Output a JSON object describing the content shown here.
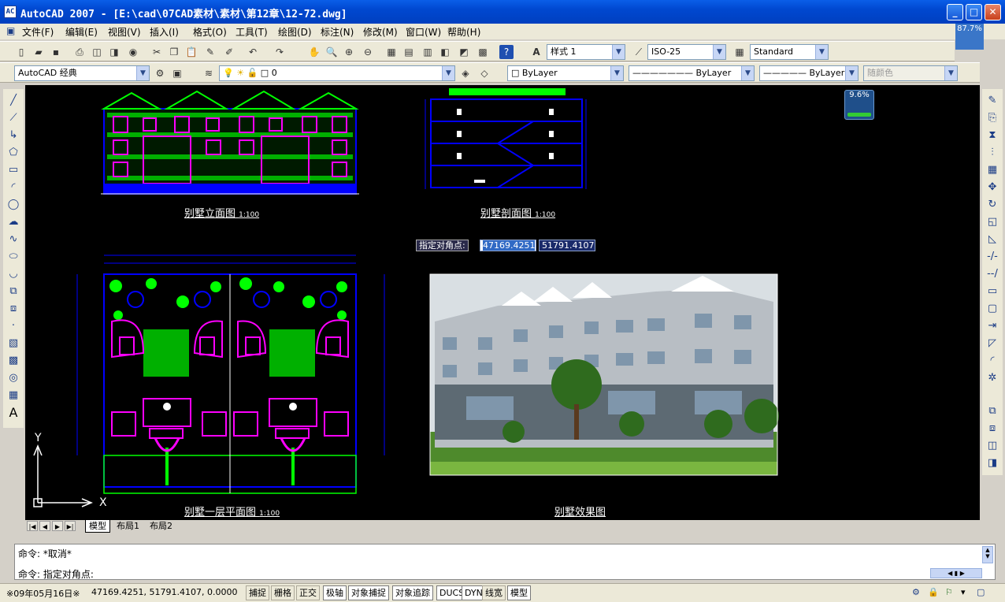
{
  "window": {
    "title": "AutoCAD 2007 - [E:\\cad\\07CAD素材\\素材\\第12章\\12-72.dwg]",
    "icon_label": "AC"
  },
  "menu": [
    "文件(F)",
    "编辑(E)",
    "视图(V)",
    "插入(I)",
    "格式(O)",
    "工具(T)",
    "绘图(D)",
    "标注(N)",
    "修改(M)",
    "窗口(W)",
    "帮助(H)"
  ],
  "indicator_top": "87.7%",
  "indicator_canvas": "9.6%",
  "toolbar": {
    "text_style": "样式 1",
    "dim_style": "ISO-25",
    "table_style": "Standard",
    "workspace": "AutoCAD 经典",
    "layer": "0",
    "color": "ByLayer",
    "linetype": "ByLayer",
    "lineweight": "ByLayer",
    "plot_style": "随颜色"
  },
  "drawing": {
    "labels": {
      "elevation": "别墅立面图",
      "section": "别墅剖面图",
      "plan": "别墅一层平面图",
      "render": "别墅效果图",
      "scale": "1:100"
    },
    "prompt": {
      "label": "指定对角点:",
      "x": "47169.4251",
      "y": "51791.4107"
    },
    "ucs": {
      "x": "X",
      "y": "Y"
    }
  },
  "tabs": [
    "模型",
    "布局1",
    "布局2"
  ],
  "command": {
    "line1": "命令: *取消*",
    "line2": "命令: 指定对角点:"
  },
  "status": {
    "date": "※09年05月16日※",
    "coords": "47169.4251, 51791.4107, 0.0000",
    "buttons": [
      "捕捉",
      "栅格",
      "正交",
      "极轴",
      "对象捕捉",
      "对象追踪",
      "DUCS",
      "DYN",
      "线宽",
      "模型"
    ]
  },
  "colors": {
    "title_bar": "#0048d0",
    "canvas": "#000000",
    "cad_green": "#00ff00",
    "cad_magenta": "#ff00ff",
    "cad_blue": "#0000ff"
  },
  "icons": {
    "left": [
      "line-icon",
      "construction-line-icon",
      "polyline-icon",
      "polygon-icon",
      "rectangle-icon",
      "arc-icon",
      "circle-icon",
      "revision-cloud-icon",
      "spline-icon",
      "ellipse-icon",
      "ellipse-arc-icon",
      "insert-block-icon",
      "make-block-icon",
      "point-icon",
      "hatch-icon",
      "gradient-icon",
      "region-icon",
      "table-icon",
      "multiline-text-icon"
    ],
    "right": [
      "erase-icon",
      "copy-icon",
      "mirror-icon",
      "offset-icon",
      "array-icon",
      "move-icon",
      "rotate-icon",
      "scale-icon",
      "stretch-icon",
      "trim-icon",
      "extend-icon",
      "break-at-point-icon",
      "break-icon",
      "join-icon",
      "chamfer-icon",
      "fillet-icon",
      "explode-icon"
    ]
  }
}
